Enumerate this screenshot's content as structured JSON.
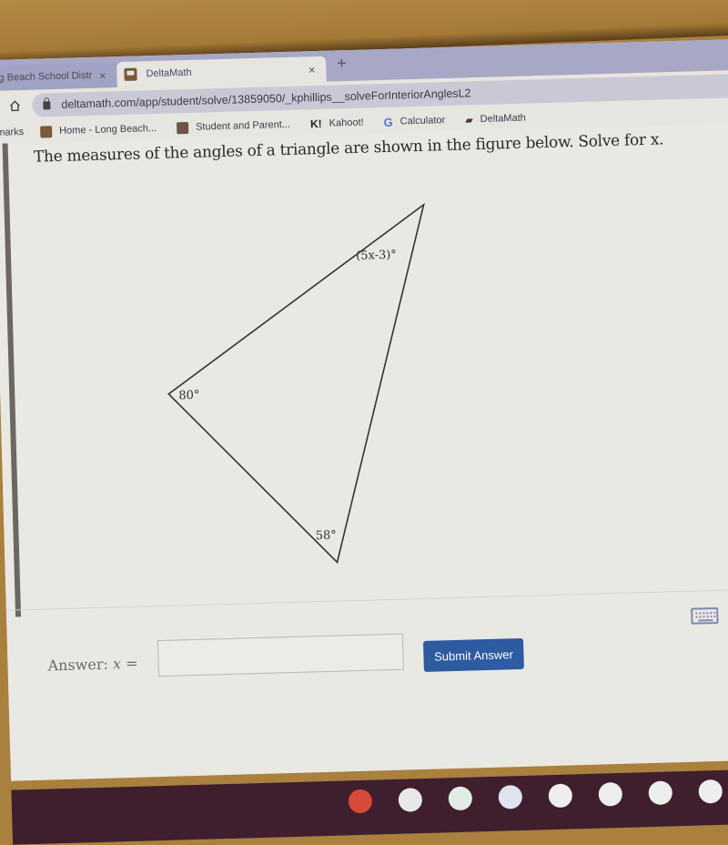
{
  "browser": {
    "tabs": [
      {
        "label": "g Beach School Distr",
        "active": false
      },
      {
        "label": "DeltaMath",
        "active": true
      }
    ],
    "tab_close_glyph": "×",
    "new_tab_glyph": "+",
    "url": "deltamath.com/app/student/solve/13859050/_kphillips__solveForInteriorAnglesL2",
    "bookmarks_label": "marks",
    "bookmarks": [
      {
        "label": "Home - Long Beach...",
        "icon": "house-icon"
      },
      {
        "label": "Student and Parent...",
        "icon": "ss-icon"
      },
      {
        "label": "Kahoot!",
        "icon": "kahoot-icon",
        "glyph": "K!"
      },
      {
        "label": "Calculator",
        "icon": "google-icon",
        "glyph": "G"
      },
      {
        "label": "DeltaMath",
        "icon": "graduation-cap-icon",
        "glyph": "▰"
      }
    ]
  },
  "problem": {
    "question": "The measures of the angles of a triangle are shown in the figure below. Solve for x.",
    "angles": {
      "top": "(5x-3)°",
      "left": "80°",
      "bottom": "58°"
    }
  },
  "answer": {
    "label": "Answer:",
    "variable": "x",
    "equals": "=",
    "value": "",
    "submit_label": "Submit Answer",
    "plus_glyph": "+"
  },
  "colors": {
    "submit": "#2d5aa0",
    "shelf": "#3f1f2e"
  }
}
